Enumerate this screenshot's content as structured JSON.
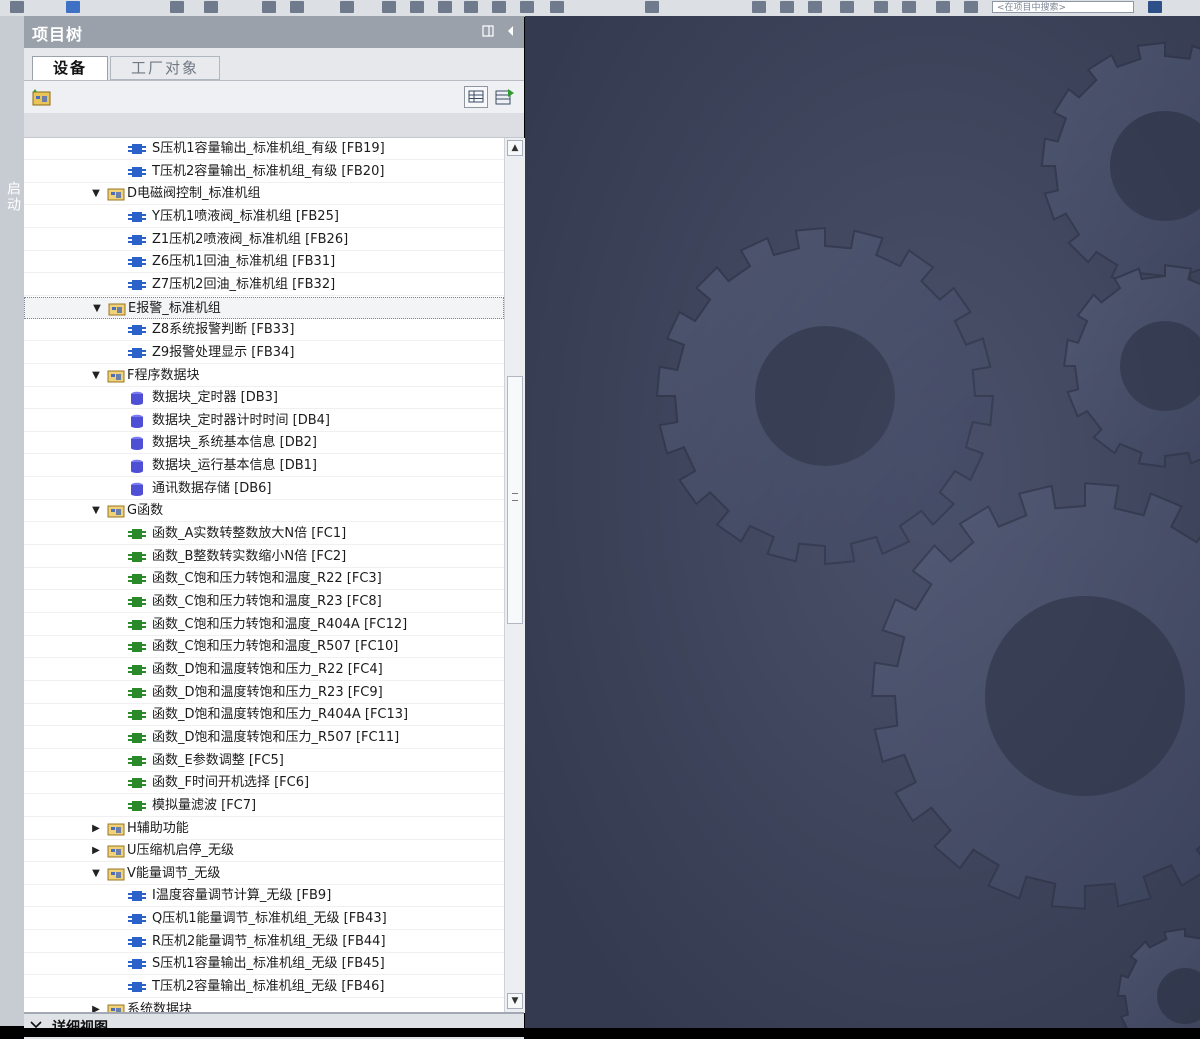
{
  "toolbar": {
    "search_placeholder": "<在项目中搜索>"
  },
  "left_strip": {
    "label": "启动"
  },
  "panel": {
    "title": "项目树",
    "tabs": [
      {
        "label": "设备",
        "active": true
      },
      {
        "label": "工厂对象",
        "active": false
      }
    ]
  },
  "tree": {
    "items": [
      {
        "label": "S压机1容量输出_标准机组_有级 [FB19]",
        "type": "fb",
        "level": 2
      },
      {
        "label": "T压机2容量输出_标准机组_有级 [FB20]",
        "type": "fb",
        "level": 2
      },
      {
        "label": "D电磁阀控制_标准机组",
        "type": "folder",
        "level": 1,
        "expanded": true
      },
      {
        "label": "Y压机1喷液阀_标准机组 [FB25]",
        "type": "fb",
        "level": 2
      },
      {
        "label": "Z1压机2喷液阀_标准机组 [FB26]",
        "type": "fb",
        "level": 2
      },
      {
        "label": "Z6压机1回油_标准机组 [FB31]",
        "type": "fb",
        "level": 2
      },
      {
        "label": "Z7压机2回油_标准机组 [FB32]",
        "type": "fb",
        "level": 2
      },
      {
        "label": "E报警_标准机组",
        "type": "folder",
        "level": 1,
        "expanded": true,
        "selected": true
      },
      {
        "label": "Z8系统报警判断 [FB33]",
        "type": "fb",
        "level": 2
      },
      {
        "label": "Z9报警处理显示 [FB34]",
        "type": "fb",
        "level": 2
      },
      {
        "label": "F程序数据块",
        "type": "folder",
        "level": 1,
        "expanded": true
      },
      {
        "label": "数据块_定时器 [DB3]",
        "type": "db",
        "level": 2
      },
      {
        "label": "数据块_定时器计时时间 [DB4]",
        "type": "db",
        "level": 2
      },
      {
        "label": "数据块_系统基本信息 [DB2]",
        "type": "db",
        "level": 2
      },
      {
        "label": "数据块_运行基本信息 [DB1]",
        "type": "db",
        "level": 2
      },
      {
        "label": "通讯数据存储 [DB6]",
        "type": "db",
        "level": 2
      },
      {
        "label": "G函数",
        "type": "folder",
        "level": 1,
        "expanded": true
      },
      {
        "label": "函数_A实数转整数放大N倍 [FC1]",
        "type": "fc",
        "level": 2
      },
      {
        "label": "函数_B整数转实数缩小N倍 [FC2]",
        "type": "fc",
        "level": 2
      },
      {
        "label": "函数_C饱和压力转饱和温度_R22 [FC3]",
        "type": "fc",
        "level": 2
      },
      {
        "label": "函数_C饱和压力转饱和温度_R23 [FC8]",
        "type": "fc",
        "level": 2
      },
      {
        "label": "函数_C饱和压力转饱和温度_R404A [FC12]",
        "type": "fc",
        "level": 2
      },
      {
        "label": "函数_C饱和压力转饱和温度_R507 [FC10]",
        "type": "fc",
        "level": 2
      },
      {
        "label": "函数_D饱和温度转饱和压力_R22 [FC4]",
        "type": "fc",
        "level": 2
      },
      {
        "label": "函数_D饱和温度转饱和压力_R23 [FC9]",
        "type": "fc",
        "level": 2
      },
      {
        "label": "函数_D饱和温度转饱和压力_R404A [FC13]",
        "type": "fc",
        "level": 2
      },
      {
        "label": "函数_D饱和温度转饱和压力_R507 [FC11]",
        "type": "fc",
        "level": 2
      },
      {
        "label": "函数_E参数调整 [FC5]",
        "type": "fc",
        "level": 2
      },
      {
        "label": "函数_F时间开机选择 [FC6]",
        "type": "fc",
        "level": 2
      },
      {
        "label": "模拟量滤波 [FC7]",
        "type": "fc",
        "level": 2
      },
      {
        "label": "H辅助功能",
        "type": "folder",
        "level": 1,
        "expanded": false
      },
      {
        "label": "U压缩机启停_无级",
        "type": "folder",
        "level": 1,
        "expanded": false
      },
      {
        "label": "V能量调节_无级",
        "type": "folder",
        "level": 1,
        "expanded": true
      },
      {
        "label": "I温度容量调节计算_无级 [FB9]",
        "type": "fb",
        "level": 2
      },
      {
        "label": "Q压机1能量调节_标准机组_无级 [FB43]",
        "type": "fb",
        "level": 2
      },
      {
        "label": "R压机2能量调节_标准机组_无级 [FB44]",
        "type": "fb",
        "level": 2
      },
      {
        "label": "S压机1容量输出_标准机组_无级 [FB45]",
        "type": "fb",
        "level": 2
      },
      {
        "label": "T压机2容量输出_标准机组_无级 [FB46]",
        "type": "fb",
        "level": 2
      },
      {
        "label": "系统数据块",
        "type": "folder",
        "level": 1,
        "expanded": false
      }
    ]
  },
  "detail_view": {
    "label": "详细视图"
  },
  "colors": {
    "fb_icon": "#2b62c9",
    "fc_icon": "#2a8a2a",
    "db_icon": "#4f4fd6",
    "folder_icon": "#d9a83a",
    "workspace_bg": "#3c4258"
  }
}
